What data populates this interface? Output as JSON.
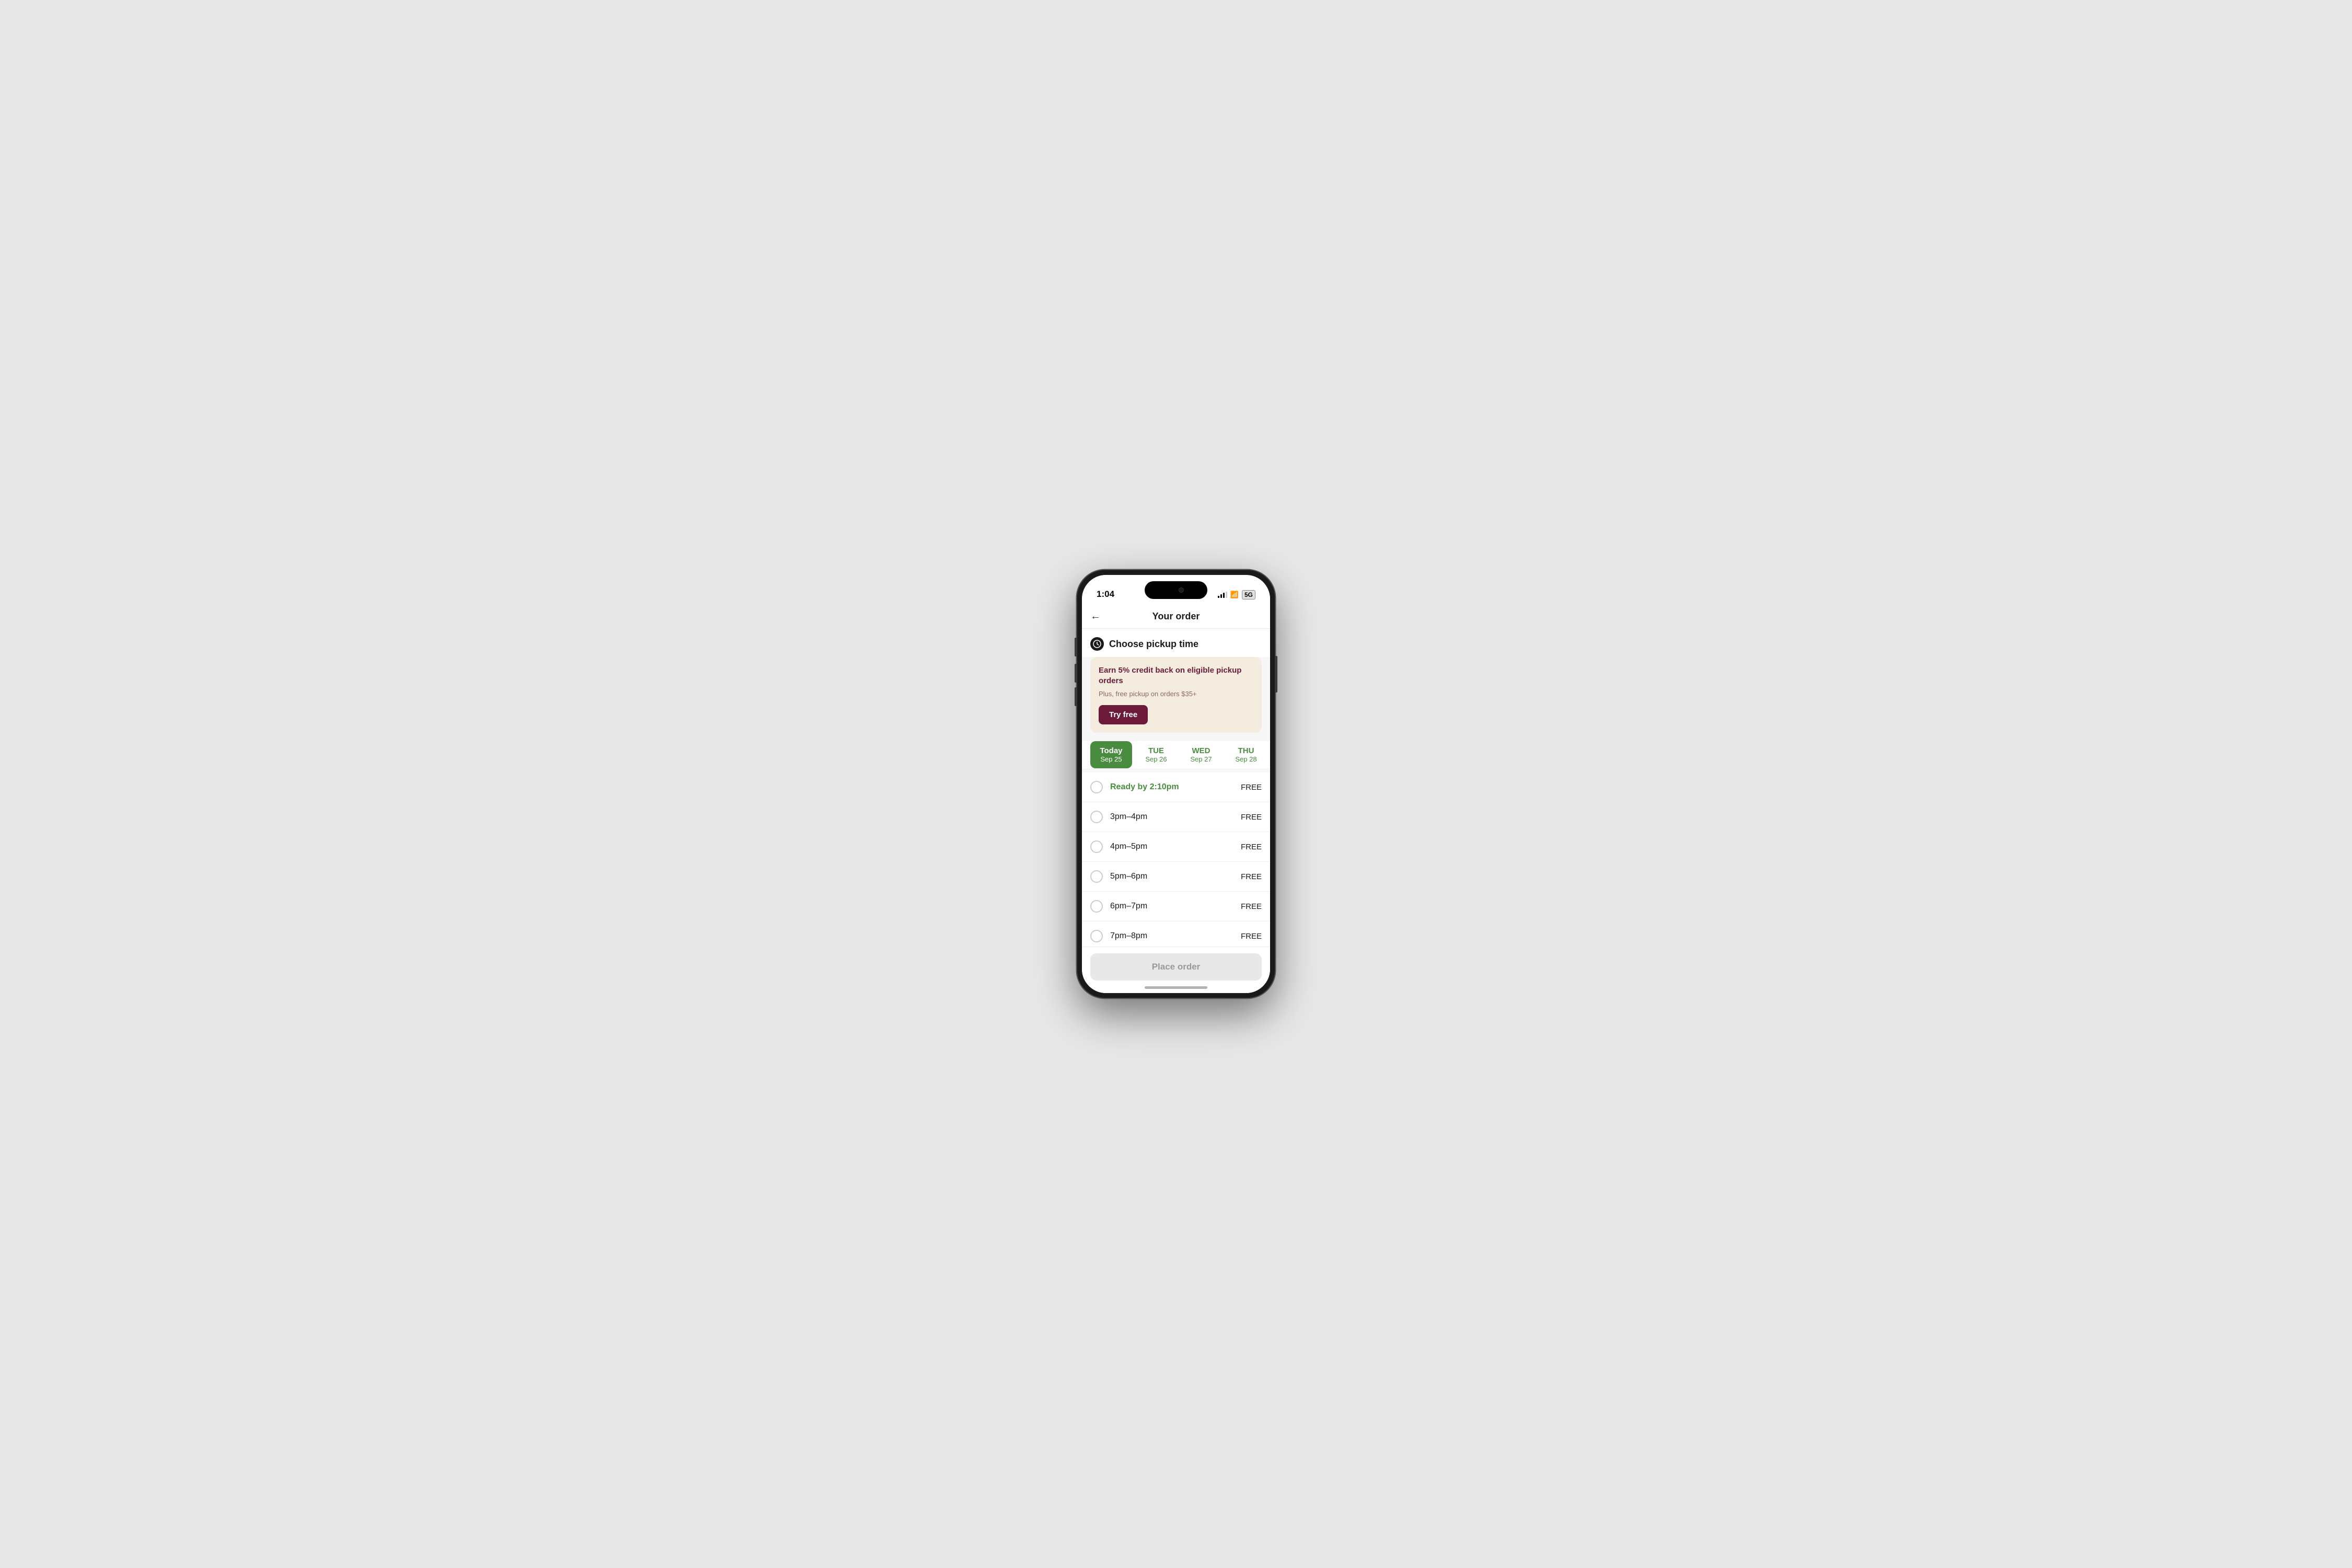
{
  "statusBar": {
    "time": "1:04",
    "batteryLabel": "5G"
  },
  "header": {
    "title": "Your order",
    "backLabel": "←"
  },
  "pickupSection": {
    "title": "Choose pickup time",
    "promoTitle": "Earn 5% credit back on eligible pickup orders",
    "promoSubtitle": "Plus, free pickup on orders $35+",
    "tryFreeLabel": "Try free"
  },
  "dateTabs": [
    {
      "day": "Today",
      "date": "Sep 25",
      "active": true
    },
    {
      "day": "TUE",
      "date": "Sep 26",
      "active": false
    },
    {
      "day": "WED",
      "date": "Sep 27",
      "active": false
    },
    {
      "day": "THU",
      "date": "Sep 28",
      "active": false
    }
  ],
  "timeSlots": [
    {
      "time": "Ready by 2:10pm",
      "price": "FREE",
      "highlighted": true
    },
    {
      "time": "3pm–4pm",
      "price": "FREE",
      "highlighted": false
    },
    {
      "time": "4pm–5pm",
      "price": "FREE",
      "highlighted": false
    },
    {
      "time": "5pm–6pm",
      "price": "FREE",
      "highlighted": false
    },
    {
      "time": "6pm–7pm",
      "price": "FREE",
      "highlighted": false
    },
    {
      "time": "7pm–8pm",
      "price": "FREE",
      "highlighted": false
    }
  ],
  "placeOrderLabel": "Place order"
}
